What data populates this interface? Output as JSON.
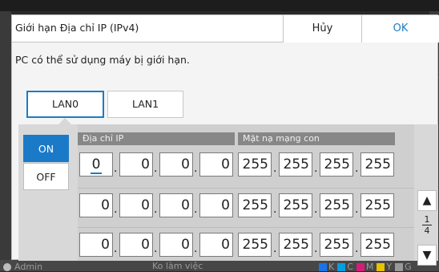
{
  "dialog": {
    "title": "Giới hạn Địa chỉ IP (IPv4)",
    "cancel_label": "Hủy",
    "ok_label": "OK",
    "description": "PC có thể sử dụng máy bị giới hạn."
  },
  "tabs": [
    {
      "label": "LAN0",
      "selected": true
    },
    {
      "label": "LAN1",
      "selected": false
    }
  ],
  "toggle": {
    "on_label": "ON",
    "off_label": "OFF",
    "selected": "ON"
  },
  "table": {
    "ip_header": "Địa chỉ IP",
    "mask_header": "Mặt nạ mạng con",
    "rows": [
      {
        "ip": [
          "0",
          "0",
          "0",
          "0"
        ],
        "mask": [
          "255",
          "255",
          "255",
          "255"
        ]
      },
      {
        "ip": [
          "0",
          "0",
          "0",
          "0"
        ],
        "mask": [
          "255",
          "255",
          "255",
          "255"
        ]
      },
      {
        "ip": [
          "0",
          "0",
          "0",
          "0"
        ],
        "mask": [
          "255",
          "255",
          "255",
          "255"
        ]
      }
    ],
    "separator": "."
  },
  "pager": {
    "current": "1",
    "total": "4",
    "up_icon": "triangle-up-icon",
    "down_icon": "triangle-down-icon"
  },
  "status_bar": {
    "user": "Admin",
    "message": "Ko làm việc",
    "inks": [
      {
        "label": "K",
        "color": "#1a73e8"
      },
      {
        "label": "C",
        "color": "#00a0e0"
      },
      {
        "label": "M",
        "color": "#d81b78"
      },
      {
        "label": "Y",
        "color": "#e6c200"
      },
      {
        "label": "G",
        "color": "#999999"
      }
    ]
  },
  "colors": {
    "accent": "#1c7cc4",
    "on_button": "#1a7ac8",
    "header_gray": "#878787"
  }
}
